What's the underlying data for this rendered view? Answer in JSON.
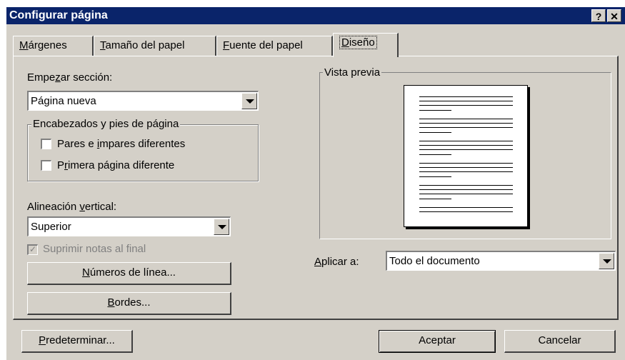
{
  "window": {
    "title": "Configurar página",
    "help_button": "?",
    "close_button": "✕"
  },
  "tabs": [
    {
      "pre": "",
      "key": "M",
      "post": "árgenes"
    },
    {
      "pre": "",
      "key": "T",
      "post": "amaño del papel"
    },
    {
      "pre": "",
      "key": "F",
      "post": "uente del papel"
    },
    {
      "pre": "",
      "key": "D",
      "post": "iseño"
    }
  ],
  "section_start": {
    "label_pre": "Empe",
    "label_key": "z",
    "label_post": "ar sección:",
    "value": "Página nueva"
  },
  "headers_group": {
    "legend": "Encabezados y pies de página",
    "odd_even": {
      "pre": "Pares e ",
      "key": "i",
      "post": "mpares diferentes",
      "checked": false
    },
    "first_page": {
      "pre": "P",
      "key": "r",
      "post": "imera página diferente",
      "checked": false
    }
  },
  "vertical_alignment": {
    "label_pre": "Alineación ",
    "label_key": "v",
    "label_post": "ertical:",
    "value": "Superior"
  },
  "suppress_endnotes": {
    "label": "Suprimir notas al final",
    "checked": true,
    "enabled": false
  },
  "line_numbers_button": {
    "pre": "",
    "key": "N",
    "post": "úmeros de línea..."
  },
  "borders_button": {
    "pre": "",
    "key": "B",
    "post": "ordes..."
  },
  "preview": {
    "legend": "Vista previa"
  },
  "apply_to": {
    "label_pre": "",
    "label_key": "A",
    "label_post": "plicar a:",
    "value": "Todo el documento"
  },
  "footer": {
    "default_button": {
      "pre": "",
      "key": "P",
      "post": "redeterminar..."
    },
    "ok_button": "Aceptar",
    "cancel_button": "Cancelar"
  },
  "colors": {
    "title_bar": "#0a246a",
    "dialog_face": "#d4d0c8"
  }
}
